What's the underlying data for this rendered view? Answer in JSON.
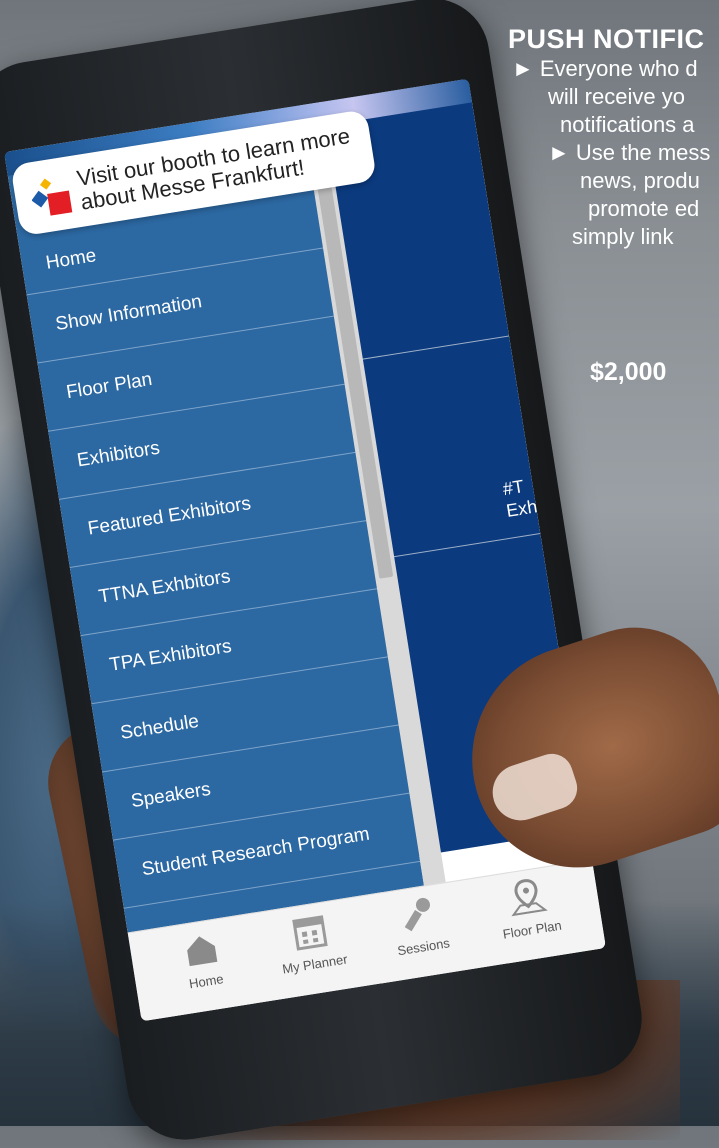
{
  "promo": {
    "title": "PUSH NOTIFIC",
    "lines": [
      "► Everyone who d",
      "will receive yo",
      "notifications a",
      "► Use the mess",
      "news, produ",
      "promote ed",
      "simply link"
    ],
    "price": "$2,000"
  },
  "banner": {
    "line1": "Visit our booth to learn more",
    "line2": "about Messe Frankfurt!"
  },
  "menu": {
    "items": [
      "Home",
      "Show Information",
      "Floor Plan",
      "Exhibitors",
      "Featured Exhibitors",
      "TTNA Exhbitors",
      "TPA Exhibitors",
      "Schedule",
      "Speakers",
      "Student Research Program"
    ]
  },
  "tiles": {
    "text_line1": "#T",
    "text_line2": "Exhi"
  },
  "bottom_nav": {
    "items": [
      {
        "label": "Home",
        "icon": "home-icon"
      },
      {
        "label": "My Planner",
        "icon": "calendar-icon"
      },
      {
        "label": "Sessions",
        "icon": "microphone-icon"
      },
      {
        "label": "Floor Plan",
        "icon": "map-pin-icon"
      }
    ]
  },
  "colors": {
    "menu_bg": "#2c68a2",
    "tile_bg": "#0b3a7e",
    "logo_red": "#e31e24",
    "logo_blue": "#1d5ba8",
    "logo_yellow": "#f5b400"
  }
}
